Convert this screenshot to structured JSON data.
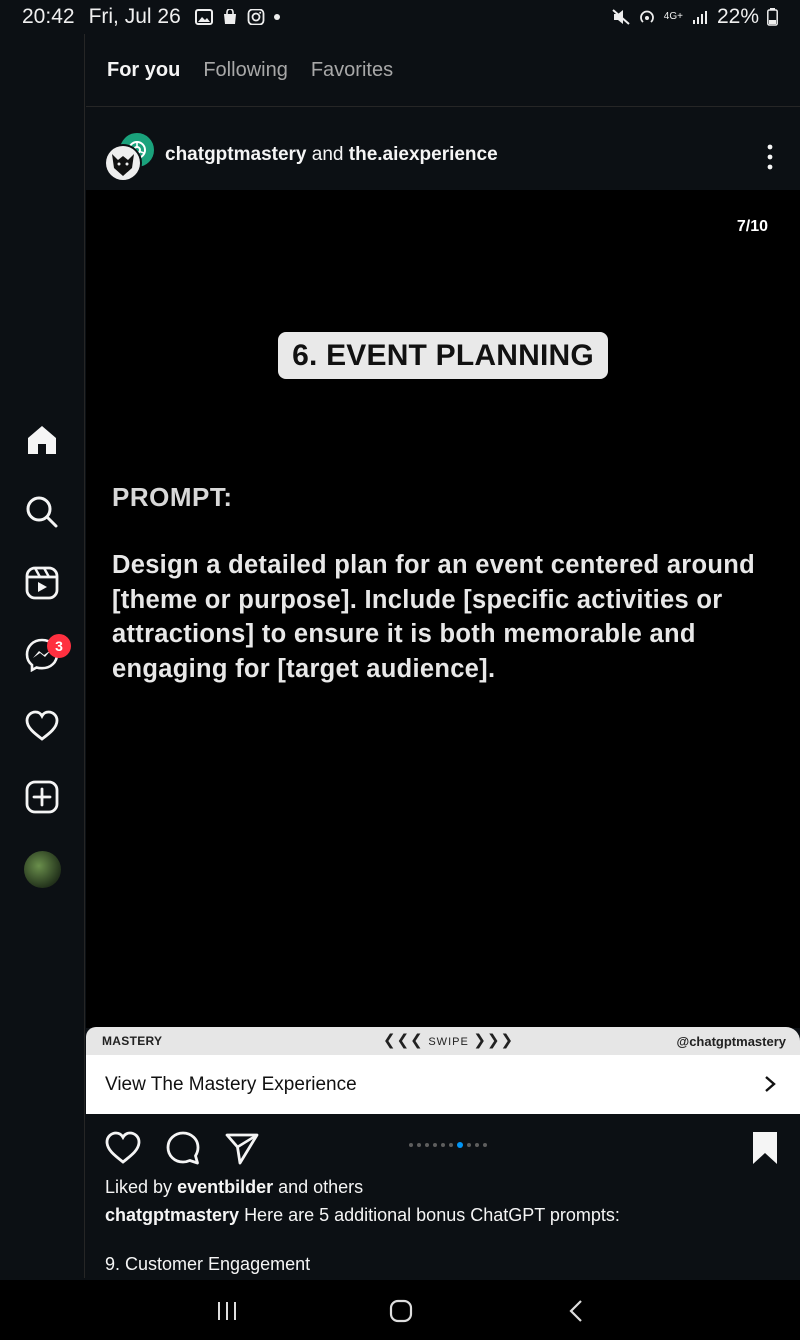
{
  "status_bar": {
    "time": "20:42",
    "date": "Fri, Jul 26",
    "network": "4G+",
    "battery": "22%"
  },
  "sidebar": {
    "items": [
      {
        "icon": "home-icon"
      },
      {
        "icon": "search-icon"
      },
      {
        "icon": "reels-icon"
      },
      {
        "icon": "messenger-icon",
        "badge": "3"
      },
      {
        "icon": "heart-icon"
      },
      {
        "icon": "create-icon"
      },
      {
        "icon": "profile-avatar"
      }
    ]
  },
  "feed_tabs": [
    {
      "label": "For you",
      "active": true
    },
    {
      "label": "Following",
      "active": false
    },
    {
      "label": "Favorites",
      "active": false
    }
  ],
  "post": {
    "author": "chatgptmastery",
    "joiner": "and",
    "coauthor": "the.aiexperience",
    "slide": {
      "counter": "7/10",
      "title": "6. EVENT PLANNING",
      "prompt_label": "PROMPT:",
      "prompt_body": "Design a detailed plan for an event centered around [theme or purpose]. Include [specific activities or attractions] to ensure it is both memorable and engaging for [target audience].",
      "footer_brand": "MASTERY",
      "footer_swipe": "SWIPE",
      "footer_handle": "@chatgptmastery",
      "current_index": 7,
      "total": 10
    },
    "cta": "View The Mastery Experience",
    "likes": {
      "prefix": "Liked by",
      "user": "eventbilder",
      "suffix": "and others"
    },
    "caption": {
      "user": "chatgptmastery",
      "text": "Here are 5 additional bonus ChatGPT prompts:"
    },
    "caption_line2": "9. Customer Engagement"
  },
  "colors": {
    "background": "#0c1014",
    "badge": "#ff3040",
    "carousel_active": "#0095f6"
  }
}
